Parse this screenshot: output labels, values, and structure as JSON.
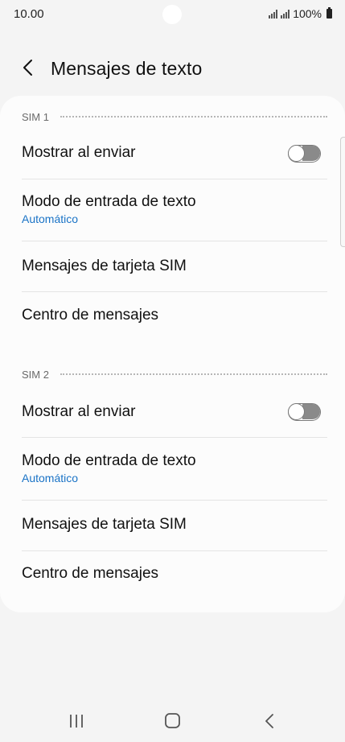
{
  "status_bar": {
    "time": "10.00",
    "battery_text": "100%"
  },
  "header": {
    "back_icon": "chevron-left-icon",
    "title": "Mensajes de texto"
  },
  "sections": [
    {
      "label": "SIM 1",
      "show_on_send": {
        "label": "Mostrar al enviar",
        "enabled": false
      },
      "input_mode": {
        "label": "Modo de entrada de texto",
        "value": "Automático"
      },
      "sim_messages": {
        "label": "Mensajes de tarjeta SIM"
      },
      "message_center": {
        "label": "Centro de mensajes"
      }
    },
    {
      "label": "SIM 2",
      "show_on_send": {
        "label": "Mostrar al enviar",
        "enabled": false
      },
      "input_mode": {
        "label": "Modo de entrada de texto",
        "value": "Automático"
      },
      "sim_messages": {
        "label": "Mensajes de tarjeta SIM"
      },
      "message_center": {
        "label": "Centro de mensajes"
      }
    }
  ],
  "nav_bar": {
    "icons": [
      "recent-apps-icon",
      "home-icon",
      "back-icon"
    ]
  },
  "colors": {
    "background": "#f4f4f4",
    "card": "#fcfcfc",
    "accent": "#1a73c6",
    "toggle_off": "#8a8a8a"
  }
}
